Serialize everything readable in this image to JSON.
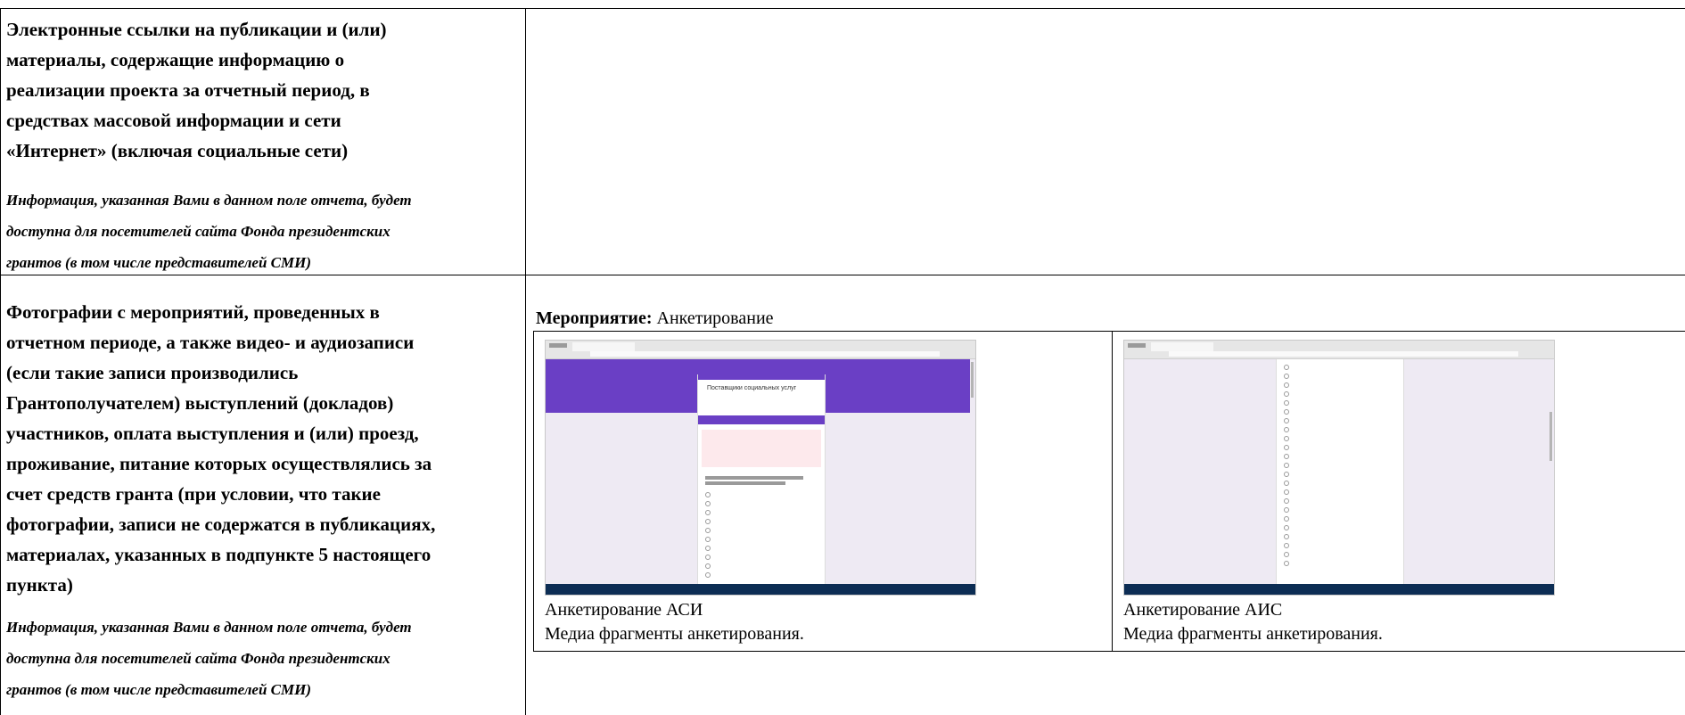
{
  "rows": [
    {
      "label_lines": [
        "Электронные ссылки на публикации и (или)",
        "материалы, содержащие информацию о",
        "реализации проекта за отчетный период, в",
        "средствах массовой информации и сети",
        "«Интернет» (включая социальные сети)"
      ],
      "note_lines": [
        "Информация, указанная Вами в данном поле отчета, будет",
        "доступна для посетителей сайта Фонда президентских",
        "грантов (в том числе представителей СМИ)"
      ]
    },
    {
      "label_lines": [
        "Фотографии с мероприятий, проведенных в",
        "отчетном периоде, а также видео- и аудиозаписи",
        "(если такие записи производились",
        "Грантополучателем) выступлений (докладов)",
        "участников, оплата выступления и (или) проезд,",
        "проживание, питание которых осуществлялись за",
        "счет средств гранта (при условии, что такие",
        "фотографии, записи не содержатся в публикациях,",
        "материалах, указанных в подпункте 5 настоящего",
        "пункта)"
      ],
      "note_lines": [
        "Информация, указанная Вами в данном поле отчета, будет",
        "доступна для посетителей сайта Фонда президентских",
        "грантов (в том числе представителей СМИ)"
      ]
    }
  ],
  "event": {
    "label": "Мероприятие:",
    "value": "Анкетирование"
  },
  "media": [
    {
      "title": "Анкетирование АСИ",
      "description": "Медиа фрагменты анкетирования.",
      "screenshot_title": "Поставщики социальных услуг"
    },
    {
      "title": "Анкетирование АИС",
      "description": "Медиа фрагменты анкетирования."
    }
  ],
  "colors": {
    "form_accent": "#6a3fc5",
    "form_background": "#eeeaf3",
    "taskbar": "#0c2d54"
  }
}
